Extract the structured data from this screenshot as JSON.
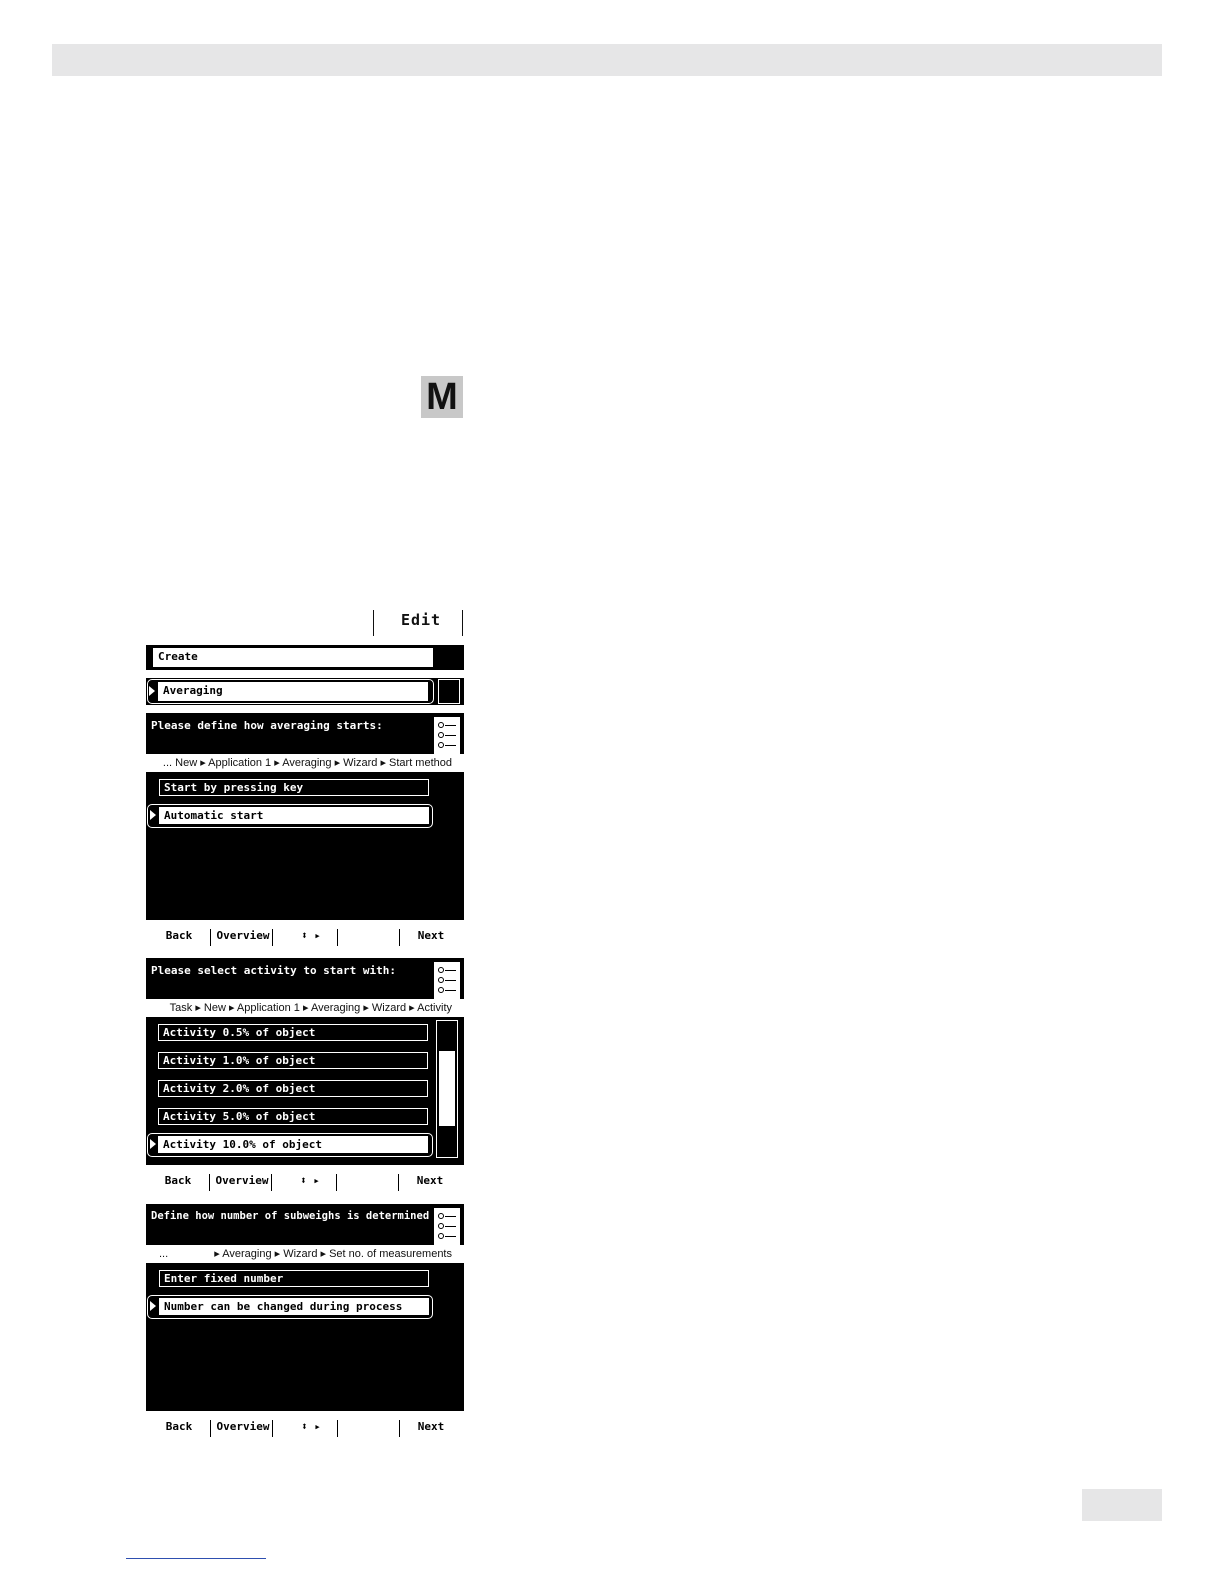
{
  "page": {
    "key_m": "M"
  },
  "edit_header": {
    "edit_label": "Edit",
    "create_label": "Create",
    "application_label": "Averaging"
  },
  "screen1": {
    "title": "Please define how averaging starts:",
    "breadcrumb": "... New ▸ Application 1 ▸ Averaging ▸ Wizard ▸ Start method",
    "options": [
      "Start by pressing key",
      "Automatic start"
    ],
    "selected_index": 1
  },
  "screen2": {
    "title": "Please select activity to start with:",
    "breadcrumb": "Task ▸ New ▸ Application 1 ▸ Averaging ▸ Wizard ▸ Activity",
    "options": [
      "Activity 0.5% of object",
      "Activity 1.0% of object",
      "Activity 2.0% of object",
      "Activity 5.0% of object",
      "Activity 10.0% of object"
    ],
    "selected_index": 4
  },
  "screen3": {
    "title": "Define how number of subweighs is determined",
    "breadcrumb_prefix": "...",
    "breadcrumb": "▸ Averaging ▸ Wizard ▸ Set no. of measurements",
    "options": [
      "Enter fixed number",
      "Number can be changed during process"
    ],
    "selected_index": 1
  },
  "softkeys": {
    "back": "Back",
    "overview": "Overview",
    "nav": "⬍ ▸",
    "next": "Next"
  }
}
